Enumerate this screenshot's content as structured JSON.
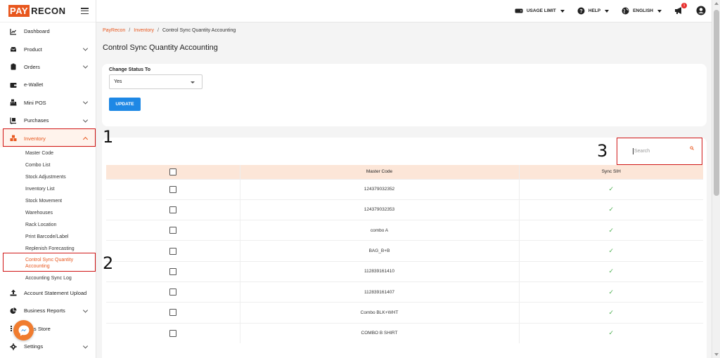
{
  "brand": {
    "part1": "PAY",
    "part2": "RECON"
  },
  "colors": {
    "accent": "#e8571e",
    "primary": "#1e88e5",
    "highlight": "#d01515",
    "check": "#4caf50"
  },
  "sidebar": {
    "items": [
      {
        "label": "Dashboard",
        "icon": "chart-line-icon"
      },
      {
        "label": "Product",
        "icon": "inbox-icon"
      },
      {
        "label": "Orders",
        "icon": "clipboard-icon"
      },
      {
        "label": "e-Wallet",
        "icon": "wallet-icon"
      },
      {
        "label": "Mini POS",
        "icon": "cash-register-icon"
      },
      {
        "label": "Purchases",
        "icon": "dolly-icon"
      },
      {
        "label": "Inventory",
        "icon": "warehouse-icon"
      }
    ],
    "inventory_sub": [
      "Master Code",
      "Combo List",
      "Stock Adjustments",
      "Inventory List",
      "Stock Movement",
      "Warehouses",
      "Rack Location",
      "Print Barcode/Label",
      "Replenish Forecasting",
      "Control Sync Quantity Accounting",
      "Accounting Sync Log"
    ],
    "after_items": [
      {
        "label": "Account Statement Upload",
        "icon": "upload-icon"
      },
      {
        "label": "Business Reports",
        "icon": "pie-chart-icon"
      },
      {
        "label": "s Store",
        "icon": "store-icon"
      },
      {
        "label": "Settings",
        "icon": "gear-icon"
      }
    ]
  },
  "topbar": {
    "usage_limit": "USAGE LIMIT",
    "help": "HELP",
    "language": "ENGLISH",
    "notification_count": "1"
  },
  "breadcrumb": {
    "home": "PayRecon",
    "section": "Inventory",
    "current": "Control Sync Quantity Accounting"
  },
  "page_title": "Control Sync Quantity Accounting",
  "form": {
    "label": "Change Status To",
    "selected": "Yes",
    "button": "UPDATE"
  },
  "search": {
    "placeholder": "Search"
  },
  "table": {
    "headers": {
      "master_code": "Master Code",
      "sync": "Sync SIH"
    },
    "rows": [
      {
        "code": "124379032352",
        "sync": "✓"
      },
      {
        "code": "124379032353",
        "sync": "✓"
      },
      {
        "code": "combo A",
        "sync": "✓"
      },
      {
        "code": "BAG_B+B",
        "sync": "✓"
      },
      {
        "code": "112839161410",
        "sync": "✓"
      },
      {
        "code": "112839161407",
        "sync": "✓"
      },
      {
        "code": "Combo BLK+WHT",
        "sync": "✓"
      },
      {
        "code": "COMBO B SHIRT",
        "sync": "✓"
      }
    ]
  },
  "annotations": {
    "n1": "1",
    "n2": "2",
    "n3": "3"
  }
}
